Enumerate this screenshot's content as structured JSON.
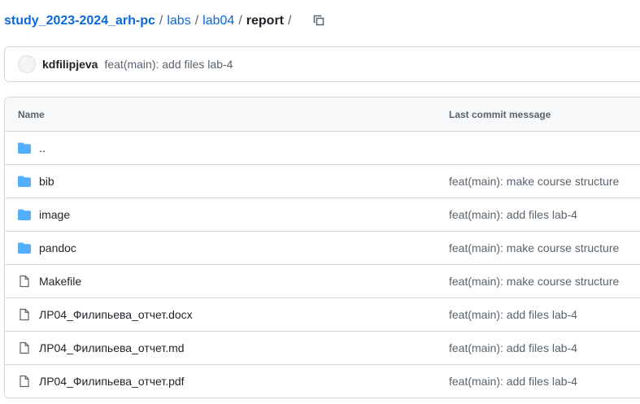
{
  "breadcrumb": {
    "repo": "study_2023-2024_arh-pc",
    "segments": [
      "labs",
      "lab04"
    ],
    "current": "report",
    "separator": "/"
  },
  "latest_commit": {
    "author": "kdfilipjeva",
    "message": "feat(main): add files lab-4"
  },
  "table": {
    "headers": {
      "name": "Name",
      "last_commit_message": "Last commit message"
    },
    "rows": [
      {
        "type": "folder",
        "name": "..",
        "message": ""
      },
      {
        "type": "folder",
        "name": "bib",
        "message": "feat(main): make course structure"
      },
      {
        "type": "folder",
        "name": "image",
        "message": "feat(main): add files lab-4"
      },
      {
        "type": "folder",
        "name": "pandoc",
        "message": "feat(main): make course structure"
      },
      {
        "type": "file",
        "name": "Makefile",
        "message": "feat(main): make course structure"
      },
      {
        "type": "file",
        "name": "ЛР04_Филипьева_отчет.docx",
        "message": "feat(main): add files lab-4"
      },
      {
        "type": "file",
        "name": "ЛР04_Филипьева_отчет.md",
        "message": "feat(main): add files lab-4"
      },
      {
        "type": "file",
        "name": "ЛР04_Филипьева_отчет.pdf",
        "message": "feat(main): add files lab-4"
      }
    ]
  },
  "icons": {
    "folder": "folder-icon",
    "file": "file-icon",
    "copy": "copy-icon"
  },
  "colors": {
    "link": "#0969da",
    "folder": "#54aeff",
    "muted": "#59636e",
    "border": "#d1d9e0"
  }
}
